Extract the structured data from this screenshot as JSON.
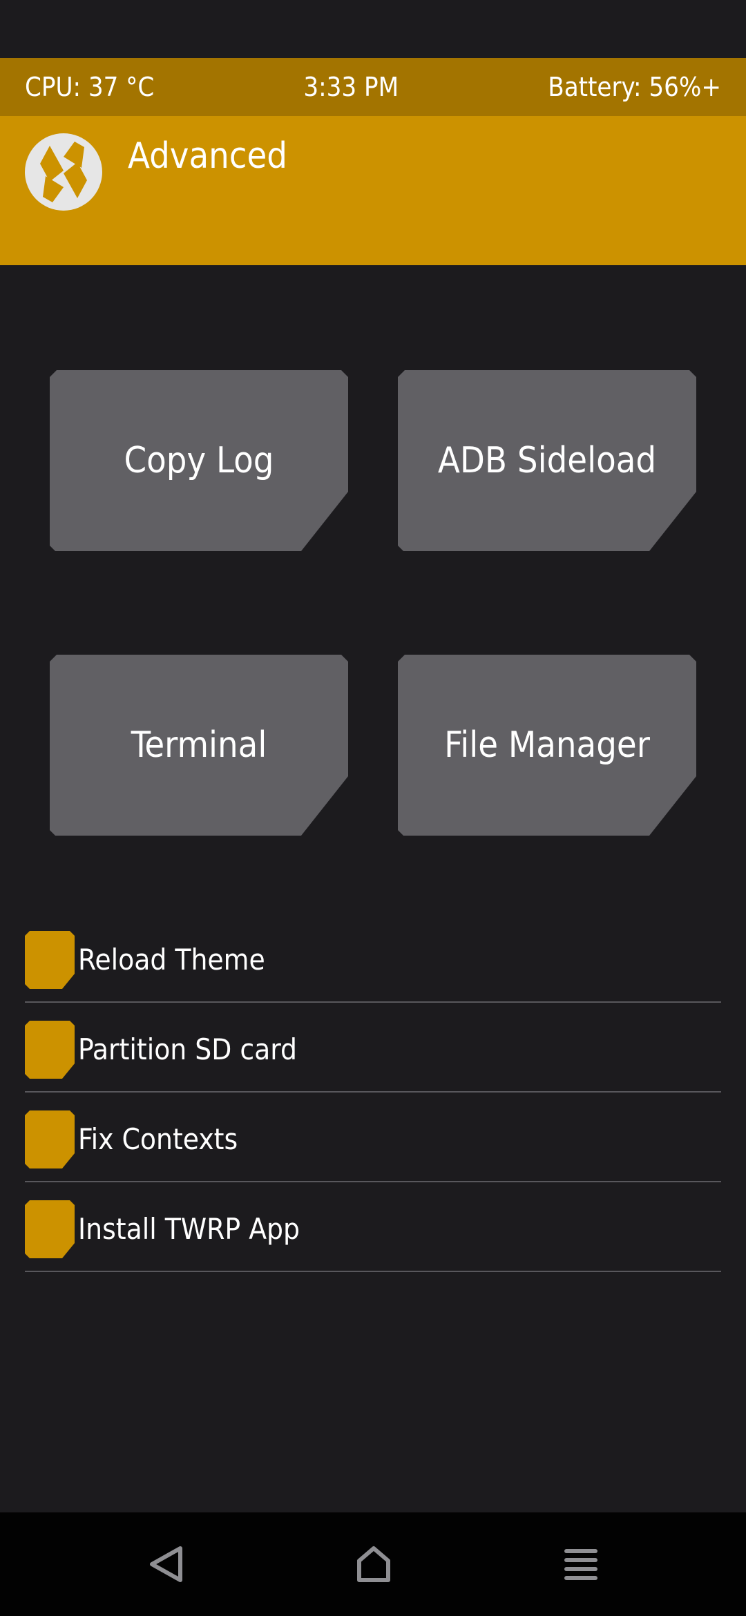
{
  "status_bar": {
    "cpu": "CPU: 37 °C",
    "time": "3:33 PM",
    "battery": "Battery: 56%+"
  },
  "header": {
    "title": "Advanced",
    "logo_icon": "twrp-logo-icon"
  },
  "tiles": [
    {
      "label": "Copy Log"
    },
    {
      "label": "ADB Sideload"
    },
    {
      "label": "Terminal"
    },
    {
      "label": "File Manager"
    }
  ],
  "options": [
    {
      "label": "Reload Theme"
    },
    {
      "label": "Partition SD card"
    },
    {
      "label": "Fix Contexts"
    },
    {
      "label": "Install TWRP App"
    }
  ],
  "nav": {
    "back_icon": "back-triangle-icon",
    "home_icon": "home-icon",
    "menu_icon": "menu-icon"
  },
  "colors": {
    "accent": "#cc9200",
    "status_bar": "#a37400",
    "tile": "#616064",
    "background": "#1c1b1e",
    "nav_bar": "#020202"
  }
}
